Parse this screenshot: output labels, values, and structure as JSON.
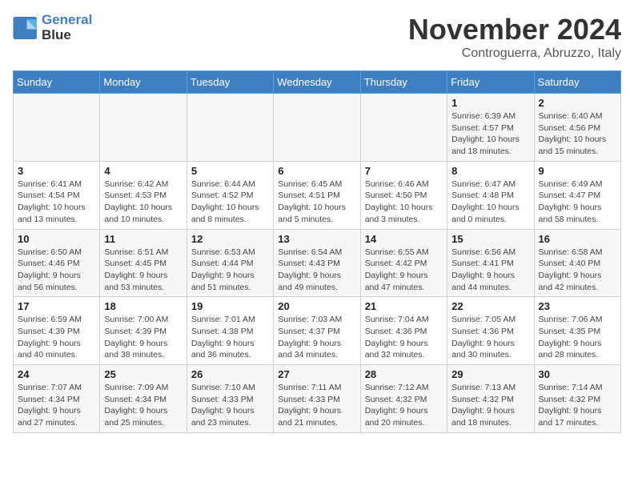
{
  "logo": {
    "line1": "General",
    "line2": "Blue"
  },
  "title": "November 2024",
  "location": "Controguerra, Abruzzo, Italy",
  "days_of_week": [
    "Sunday",
    "Monday",
    "Tuesday",
    "Wednesday",
    "Thursday",
    "Friday",
    "Saturday"
  ],
  "weeks": [
    [
      {
        "day": "",
        "info": ""
      },
      {
        "day": "",
        "info": ""
      },
      {
        "day": "",
        "info": ""
      },
      {
        "day": "",
        "info": ""
      },
      {
        "day": "",
        "info": ""
      },
      {
        "day": "1",
        "info": "Sunrise: 6:39 AM\nSunset: 4:57 PM\nDaylight: 10 hours and 18 minutes."
      },
      {
        "day": "2",
        "info": "Sunrise: 6:40 AM\nSunset: 4:56 PM\nDaylight: 10 hours and 15 minutes."
      }
    ],
    [
      {
        "day": "3",
        "info": "Sunrise: 6:41 AM\nSunset: 4:54 PM\nDaylight: 10 hours and 13 minutes."
      },
      {
        "day": "4",
        "info": "Sunrise: 6:42 AM\nSunset: 4:53 PM\nDaylight: 10 hours and 10 minutes."
      },
      {
        "day": "5",
        "info": "Sunrise: 6:44 AM\nSunset: 4:52 PM\nDaylight: 10 hours and 8 minutes."
      },
      {
        "day": "6",
        "info": "Sunrise: 6:45 AM\nSunset: 4:51 PM\nDaylight: 10 hours and 5 minutes."
      },
      {
        "day": "7",
        "info": "Sunrise: 6:46 AM\nSunset: 4:50 PM\nDaylight: 10 hours and 3 minutes."
      },
      {
        "day": "8",
        "info": "Sunrise: 6:47 AM\nSunset: 4:48 PM\nDaylight: 10 hours and 0 minutes."
      },
      {
        "day": "9",
        "info": "Sunrise: 6:49 AM\nSunset: 4:47 PM\nDaylight: 9 hours and 58 minutes."
      }
    ],
    [
      {
        "day": "10",
        "info": "Sunrise: 6:50 AM\nSunset: 4:46 PM\nDaylight: 9 hours and 56 minutes."
      },
      {
        "day": "11",
        "info": "Sunrise: 6:51 AM\nSunset: 4:45 PM\nDaylight: 9 hours and 53 minutes."
      },
      {
        "day": "12",
        "info": "Sunrise: 6:53 AM\nSunset: 4:44 PM\nDaylight: 9 hours and 51 minutes."
      },
      {
        "day": "13",
        "info": "Sunrise: 6:54 AM\nSunset: 4:43 PM\nDaylight: 9 hours and 49 minutes."
      },
      {
        "day": "14",
        "info": "Sunrise: 6:55 AM\nSunset: 4:42 PM\nDaylight: 9 hours and 47 minutes."
      },
      {
        "day": "15",
        "info": "Sunrise: 6:56 AM\nSunset: 4:41 PM\nDaylight: 9 hours and 44 minutes."
      },
      {
        "day": "16",
        "info": "Sunrise: 6:58 AM\nSunset: 4:40 PM\nDaylight: 9 hours and 42 minutes."
      }
    ],
    [
      {
        "day": "17",
        "info": "Sunrise: 6:59 AM\nSunset: 4:39 PM\nDaylight: 9 hours and 40 minutes."
      },
      {
        "day": "18",
        "info": "Sunrise: 7:00 AM\nSunset: 4:39 PM\nDaylight: 9 hours and 38 minutes."
      },
      {
        "day": "19",
        "info": "Sunrise: 7:01 AM\nSunset: 4:38 PM\nDaylight: 9 hours and 36 minutes."
      },
      {
        "day": "20",
        "info": "Sunrise: 7:03 AM\nSunset: 4:37 PM\nDaylight: 9 hours and 34 minutes."
      },
      {
        "day": "21",
        "info": "Sunrise: 7:04 AM\nSunset: 4:36 PM\nDaylight: 9 hours and 32 minutes."
      },
      {
        "day": "22",
        "info": "Sunrise: 7:05 AM\nSunset: 4:36 PM\nDaylight: 9 hours and 30 minutes."
      },
      {
        "day": "23",
        "info": "Sunrise: 7:06 AM\nSunset: 4:35 PM\nDaylight: 9 hours and 28 minutes."
      }
    ],
    [
      {
        "day": "24",
        "info": "Sunrise: 7:07 AM\nSunset: 4:34 PM\nDaylight: 9 hours and 27 minutes."
      },
      {
        "day": "25",
        "info": "Sunrise: 7:09 AM\nSunset: 4:34 PM\nDaylight: 9 hours and 25 minutes."
      },
      {
        "day": "26",
        "info": "Sunrise: 7:10 AM\nSunset: 4:33 PM\nDaylight: 9 hours and 23 minutes."
      },
      {
        "day": "27",
        "info": "Sunrise: 7:11 AM\nSunset: 4:33 PM\nDaylight: 9 hours and 21 minutes."
      },
      {
        "day": "28",
        "info": "Sunrise: 7:12 AM\nSunset: 4:32 PM\nDaylight: 9 hours and 20 minutes."
      },
      {
        "day": "29",
        "info": "Sunrise: 7:13 AM\nSunset: 4:32 PM\nDaylight: 9 hours and 18 minutes."
      },
      {
        "day": "30",
        "info": "Sunrise: 7:14 AM\nSunset: 4:32 PM\nDaylight: 9 hours and 17 minutes."
      }
    ]
  ]
}
